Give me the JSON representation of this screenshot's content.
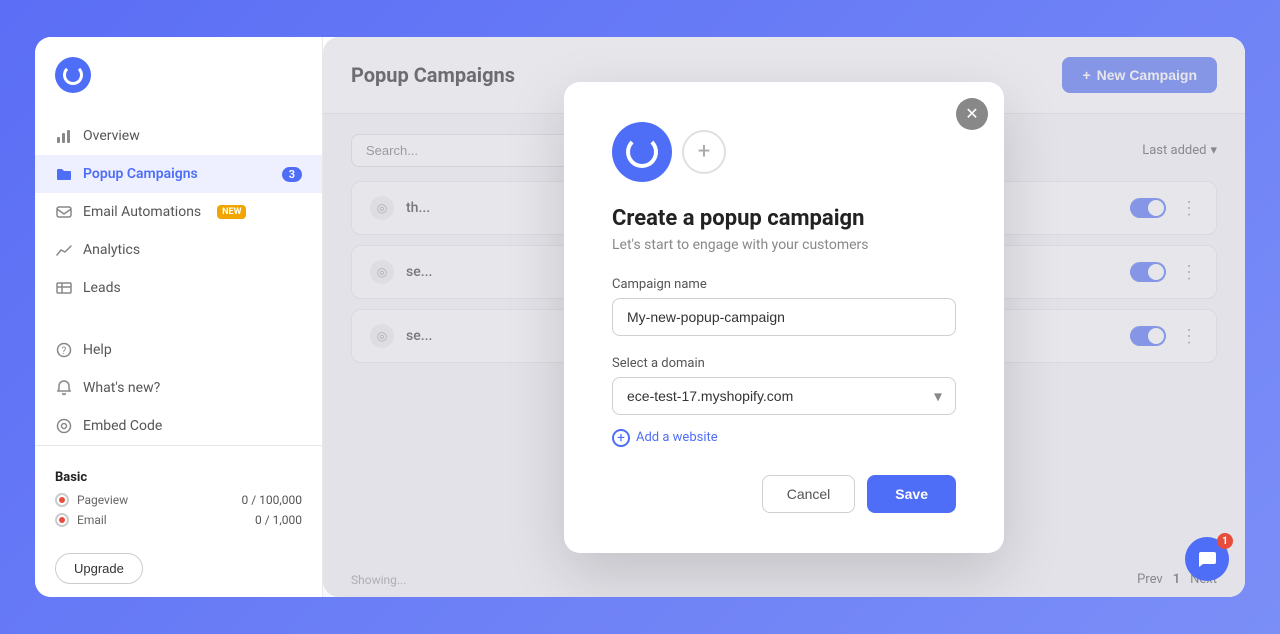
{
  "app": {
    "logo_alt": "Optinly logo"
  },
  "sidebar": {
    "items": [
      {
        "id": "overview",
        "label": "Overview",
        "icon": "chart-icon",
        "active": false,
        "badge": null,
        "badge_new": false
      },
      {
        "id": "popup-campaigns",
        "label": "Popup Campaigns",
        "icon": "folder-icon",
        "active": true,
        "badge": "3",
        "badge_new": false
      },
      {
        "id": "email-automations",
        "label": "Email Automations",
        "icon": "email-icon",
        "active": false,
        "badge": null,
        "badge_new": true
      },
      {
        "id": "analytics",
        "label": "Analytics",
        "icon": "analytics-icon",
        "active": false,
        "badge": null,
        "badge_new": false
      },
      {
        "id": "leads",
        "label": "Leads",
        "icon": "leads-icon",
        "active": false,
        "badge": null,
        "badge_new": false
      }
    ],
    "bottom_items": [
      {
        "id": "help",
        "label": "Help",
        "icon": "help-icon"
      },
      {
        "id": "whats-new",
        "label": "What's new?",
        "icon": "bell-icon"
      },
      {
        "id": "embed-code",
        "label": "Embed Code",
        "icon": "embed-icon"
      }
    ],
    "plan": {
      "title": "Basic",
      "rows": [
        {
          "label": "Pageview",
          "count": "0 / 100,000"
        },
        {
          "label": "Email",
          "count": "0 / 1,000"
        }
      ],
      "upgrade_label": "Upgrade"
    }
  },
  "main": {
    "title": "Popup Campaigns",
    "new_campaign_label": "New Campaign",
    "search_placeholder": "Search...",
    "sort_label": "Last added",
    "campaigns": [
      {
        "id": 1,
        "name": "th..."
      },
      {
        "id": 2,
        "name": "se..."
      },
      {
        "id": 3,
        "name": "se..."
      }
    ],
    "showing_text": "Showing...",
    "pagination": {
      "prev": "Prev",
      "page": "1",
      "next": "Next"
    }
  },
  "modal": {
    "title": "Create a popup campaign",
    "subtitle": "Let's start to engage with your customers",
    "campaign_name_label": "Campaign name",
    "campaign_name_value": "My-new-popup-campaign",
    "domain_label": "Select a domain",
    "domain_value": "ece-test-17.myshopify.com",
    "domain_options": [
      "ece-test-17.myshopify.com"
    ],
    "add_website_label": "Add a website",
    "cancel_label": "Cancel",
    "save_label": "Save"
  },
  "chat": {
    "badge_count": "1"
  }
}
